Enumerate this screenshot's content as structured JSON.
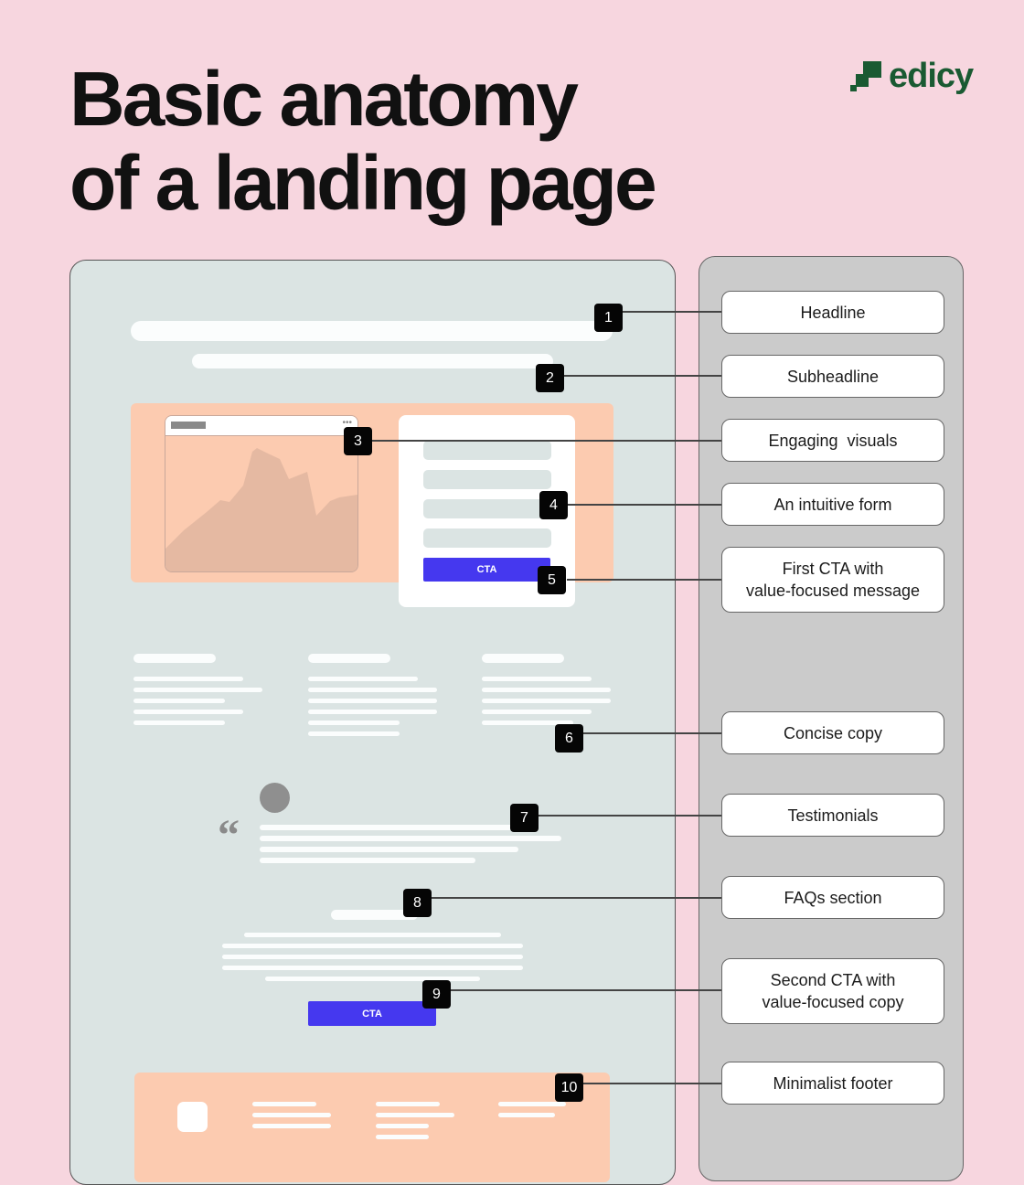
{
  "title": {
    "line1": "Basic anatomy",
    "line2": "of a landing page"
  },
  "brand": {
    "name": "edicy",
    "icon": "stair-blocks-logo-icon",
    "color": "#1a5a32"
  },
  "colors": {
    "background": "#f7d6df",
    "mockup": "#dbe4e3",
    "panel": "#cbcbcb",
    "accent_peach": "#fccbb0",
    "cta_blue": "#4538ef",
    "badge": "#050505"
  },
  "mockup": {
    "cta_primary": "CTA",
    "cta_secondary": "CTA",
    "quote_icon": "quote-mark-icon",
    "avatar_icon": "avatar-circle"
  },
  "annotations": [
    {
      "number": "1",
      "label": "Headline"
    },
    {
      "number": "2",
      "label": "Subheadline"
    },
    {
      "number": "3",
      "label": "Engaging  visuals"
    },
    {
      "number": "4",
      "label": "An intuitive form"
    },
    {
      "number": "5",
      "label_line1": "First CTA with",
      "label_line2": "value-focused message"
    },
    {
      "number": "6",
      "label": "Concise copy"
    },
    {
      "number": "7",
      "label": "Testimonials"
    },
    {
      "number": "8",
      "label": "FAQs section"
    },
    {
      "number": "9",
      "label_line1": "Second CTA with",
      "label_line2": "value-focused copy"
    },
    {
      "number": "10",
      "label": "Minimalist footer"
    }
  ]
}
